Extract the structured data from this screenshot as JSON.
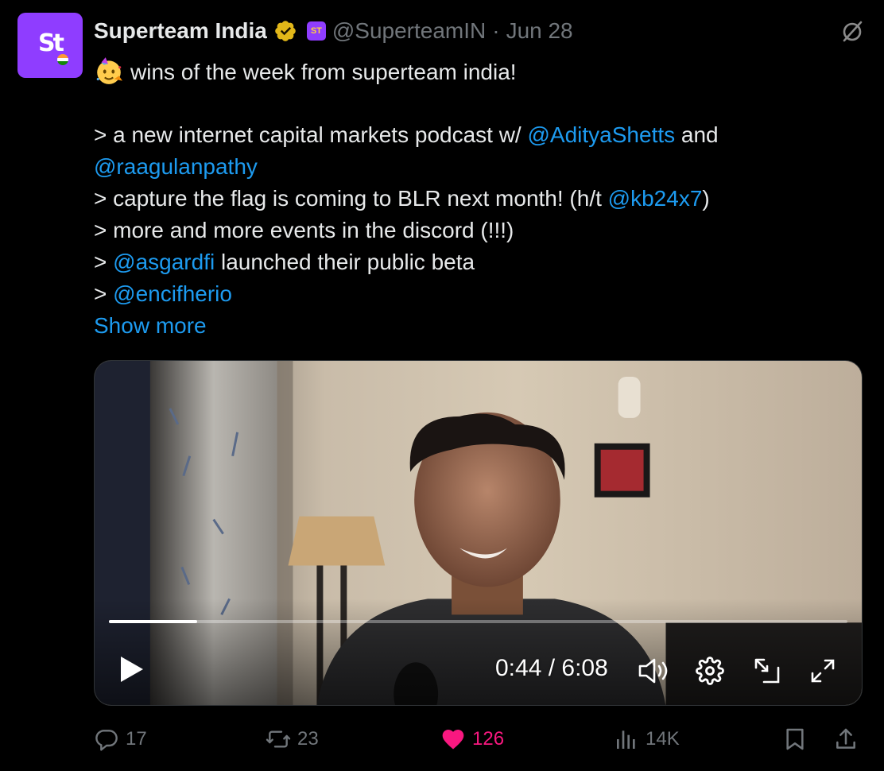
{
  "tweet": {
    "author_name": "Superteam India",
    "avatar_text": "St",
    "affiliate_badge_text": "ST",
    "handle": "@SuperteamIN",
    "separator": "·",
    "date": "Jun 28",
    "lines": [
      {
        "parts": [
          {
            "t": "wins of the week from superteam india!",
            "link": false
          }
        ]
      },
      {
        "parts": [
          {
            "t": "> a new internet capital markets podcast w/ ",
            "link": false
          },
          {
            "t": "@AdityaShetts",
            "link": true
          },
          {
            "t": " and",
            "link": false
          }
        ]
      },
      {
        "parts": [
          {
            "t": "@raagulanpathy",
            "link": true
          }
        ]
      },
      {
        "parts": [
          {
            "t": "> capture the flag is coming to BLR next month! (h/t ",
            "link": false
          },
          {
            "t": "@kb24x7",
            "link": true
          },
          {
            "t": ")",
            "link": false
          }
        ]
      },
      {
        "parts": [
          {
            "t": "> more and more events in the discord (!!!)",
            "link": false
          }
        ]
      },
      {
        "parts": [
          {
            "t": "> ",
            "link": false
          },
          {
            "t": "@asgardfi",
            "link": true
          },
          {
            "t": " launched their public beta",
            "link": false
          }
        ]
      },
      {
        "parts": [
          {
            "t": "> ",
            "link": false
          },
          {
            "t": "@encifherio",
            "link": true
          }
        ]
      }
    ],
    "show_more": "Show more"
  },
  "video": {
    "current_time": "0:44",
    "duration": "6:08",
    "time_separator": " / ",
    "progress_fraction": 0.119
  },
  "actions": {
    "replies": "17",
    "reposts": "23",
    "likes": "126",
    "views": "14K"
  },
  "colors": {
    "link": "#1d9bf0",
    "like": "#f91880",
    "brand": "#8f3dff",
    "muted": "#71767b"
  },
  "icons": [
    "verified-badge-icon",
    "grok-icon",
    "party-face-icon",
    "play-icon",
    "volume-icon",
    "settings-gear-icon",
    "picture-in-picture-icon",
    "fullscreen-icon",
    "reply-icon",
    "repost-icon",
    "heart-icon",
    "views-icon",
    "bookmark-icon",
    "share-icon"
  ]
}
